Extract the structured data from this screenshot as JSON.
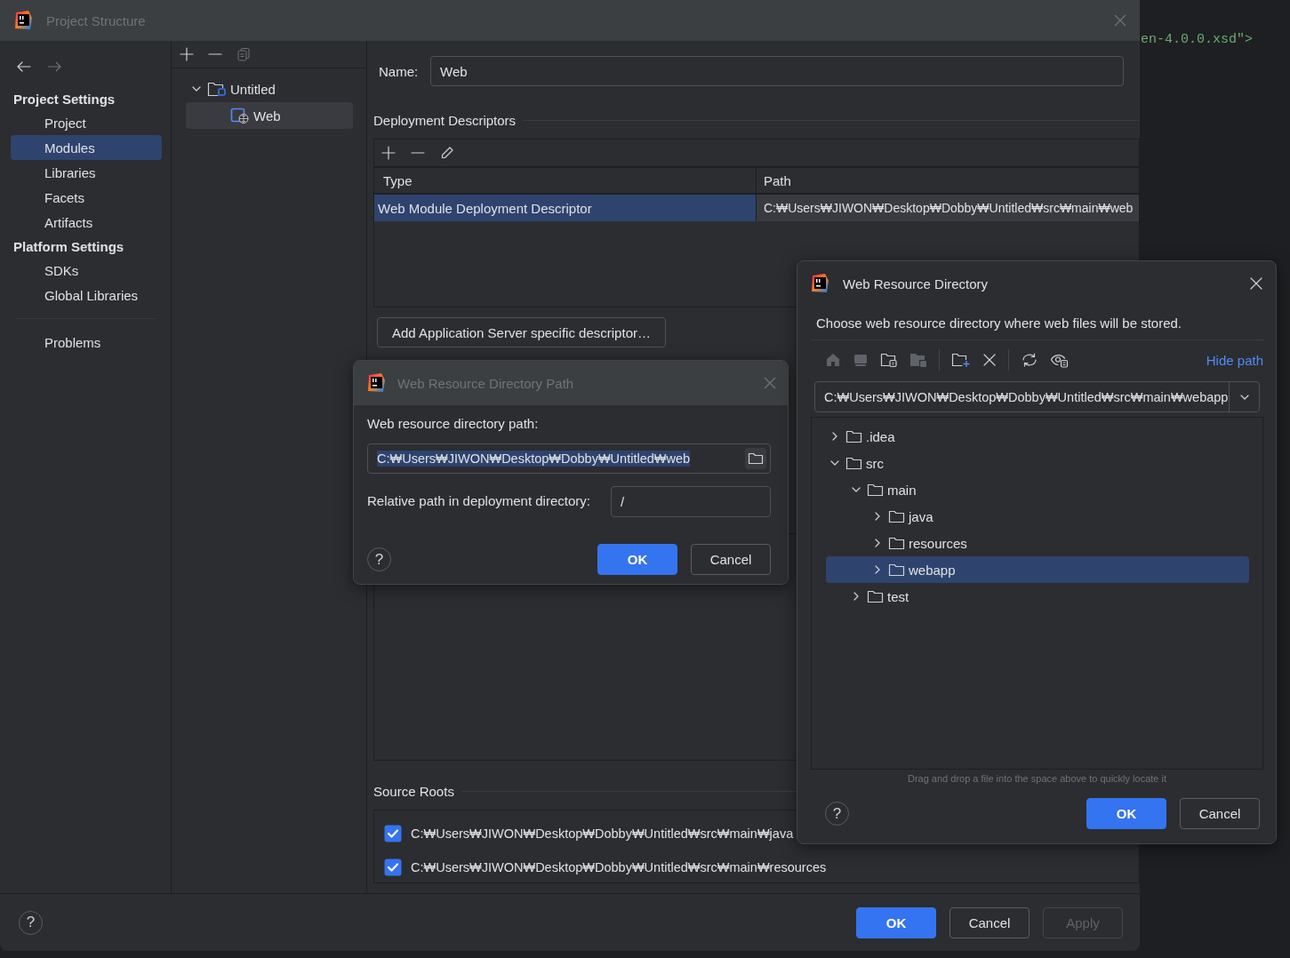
{
  "editor_background": {
    "code_fragment": "en-4.0.0.xsd\">"
  },
  "project_structure": {
    "title": "Project Structure",
    "sidebar": {
      "sections": [
        {
          "heading": "Project Settings",
          "items": [
            {
              "label": "Project",
              "selected": false
            },
            {
              "label": "Modules",
              "selected": true
            },
            {
              "label": "Libraries",
              "selected": false
            },
            {
              "label": "Facets",
              "selected": false
            },
            {
              "label": "Artifacts",
              "selected": false
            }
          ]
        },
        {
          "heading": "Platform Settings",
          "items": [
            {
              "label": "SDKs",
              "selected": false
            },
            {
              "label": "Global Libraries",
              "selected": false
            }
          ]
        }
      ],
      "bottom_items": [
        {
          "label": "Problems",
          "selected": false
        }
      ]
    },
    "module_tree": [
      {
        "label": "Untitled",
        "kind": "project",
        "expanded": true,
        "selected": false,
        "children": [
          {
            "label": "Web",
            "kind": "web_module",
            "selected": true
          }
        ]
      }
    ],
    "name_field": {
      "label": "Name:",
      "value": "Web"
    },
    "deployment_descriptors": {
      "title": "Deployment Descriptors",
      "columns": [
        "Type",
        "Path"
      ],
      "rows": [
        {
          "cells": [
            "Web Module Deployment Descriptor",
            "C:₩Users₩JIWON₩Desktop₩Dobby₩Untitled₩src₩main₩web"
          ],
          "selected": true
        }
      ],
      "add_button": "Add Application Server specific descriptor…"
    },
    "source_roots": {
      "title": "Source Roots",
      "items": [
        {
          "path": "C:₩Users₩JIWON₩Desktop₩Dobby₩Untitled₩src₩main₩java",
          "checked": true
        },
        {
          "path": "C:₩Users₩JIWON₩Desktop₩Dobby₩Untitled₩src₩main₩resources",
          "checked": true
        }
      ]
    },
    "help": "?",
    "buttons": [
      {
        "label": "OK",
        "kind": "ok",
        "disabled": false
      },
      {
        "label": "Cancel",
        "kind": "cancel",
        "disabled": false
      },
      {
        "label": "Apply",
        "kind": "apply",
        "disabled": true
      }
    ]
  },
  "path_dialog": {
    "title": "Web Resource Directory Path",
    "path_label": "Web resource directory path:",
    "path_value": "C:₩Users₩JIWON₩Desktop₩Dobby₩Untitled₩web",
    "path_selected": true,
    "relative_label": "Relative path in deployment directory:",
    "relative_value": "/",
    "help": "?",
    "buttons": [
      {
        "label": "OK",
        "kind": "ok",
        "disabled": false
      },
      {
        "label": "Cancel",
        "kind": "cancel",
        "disabled": false
      }
    ]
  },
  "directory_dialog": {
    "title": "Web Resource Directory",
    "description": "Choose web resource directory where web files will be stored.",
    "hide_path_link": "Hide path",
    "path_value": "C:₩Users₩JIWON₩Desktop₩Dobby₩Untitled₩src₩main₩webapp",
    "tree": [
      {
        "label": ".idea",
        "expanded": false,
        "selected": false
      },
      {
        "label": "src",
        "expanded": true,
        "selected": false,
        "children": [
          {
            "label": "main",
            "expanded": true,
            "selected": false,
            "children": [
              {
                "label": "java",
                "expanded": false,
                "selected": false
              },
              {
                "label": "resources",
                "expanded": false,
                "selected": false
              },
              {
                "label": "webapp",
                "expanded": false,
                "selected": true
              }
            ]
          },
          {
            "label": "test",
            "expanded": false,
            "selected": false
          }
        ]
      }
    ],
    "hint": "Drag and drop a file into the space above to quickly locate it",
    "help": "?",
    "buttons": [
      {
        "label": "OK",
        "kind": "ok",
        "disabled": false
      },
      {
        "label": "Cancel",
        "kind": "cancel",
        "disabled": false
      }
    ]
  }
}
